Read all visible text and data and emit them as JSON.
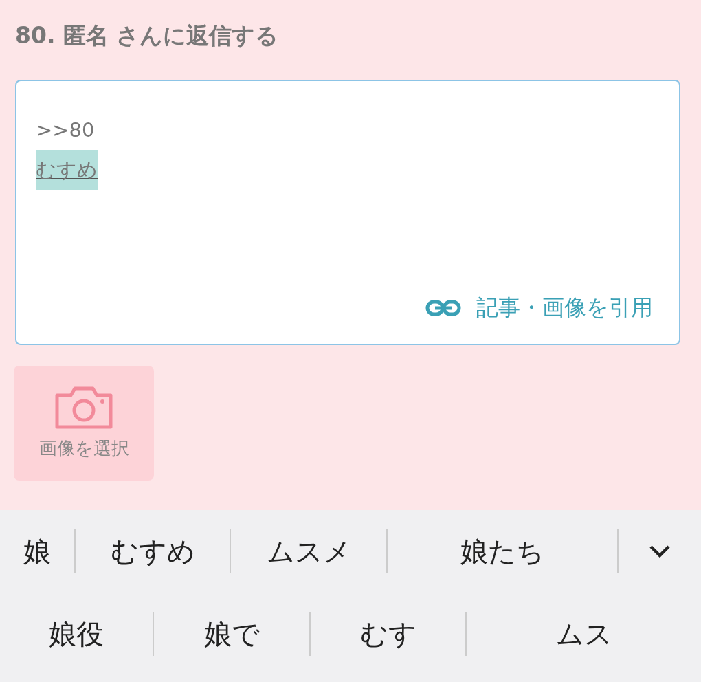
{
  "heading": "80. 匿名 さんに返信する",
  "reply_box": {
    "lines": [
      {
        "text": ">>80",
        "composing": false
      },
      {
        "text": "むすめ",
        "composing": true
      }
    ],
    "quote_link": "記事・画像を引用"
  },
  "image_button": {
    "label": "画像を選択"
  },
  "suggestions": {
    "rows": [
      [
        "娘",
        "むすめ",
        "ムスメ",
        "娘たち"
      ],
      [
        "娘役",
        "娘で",
        "むす",
        "ムス"
      ]
    ]
  }
}
